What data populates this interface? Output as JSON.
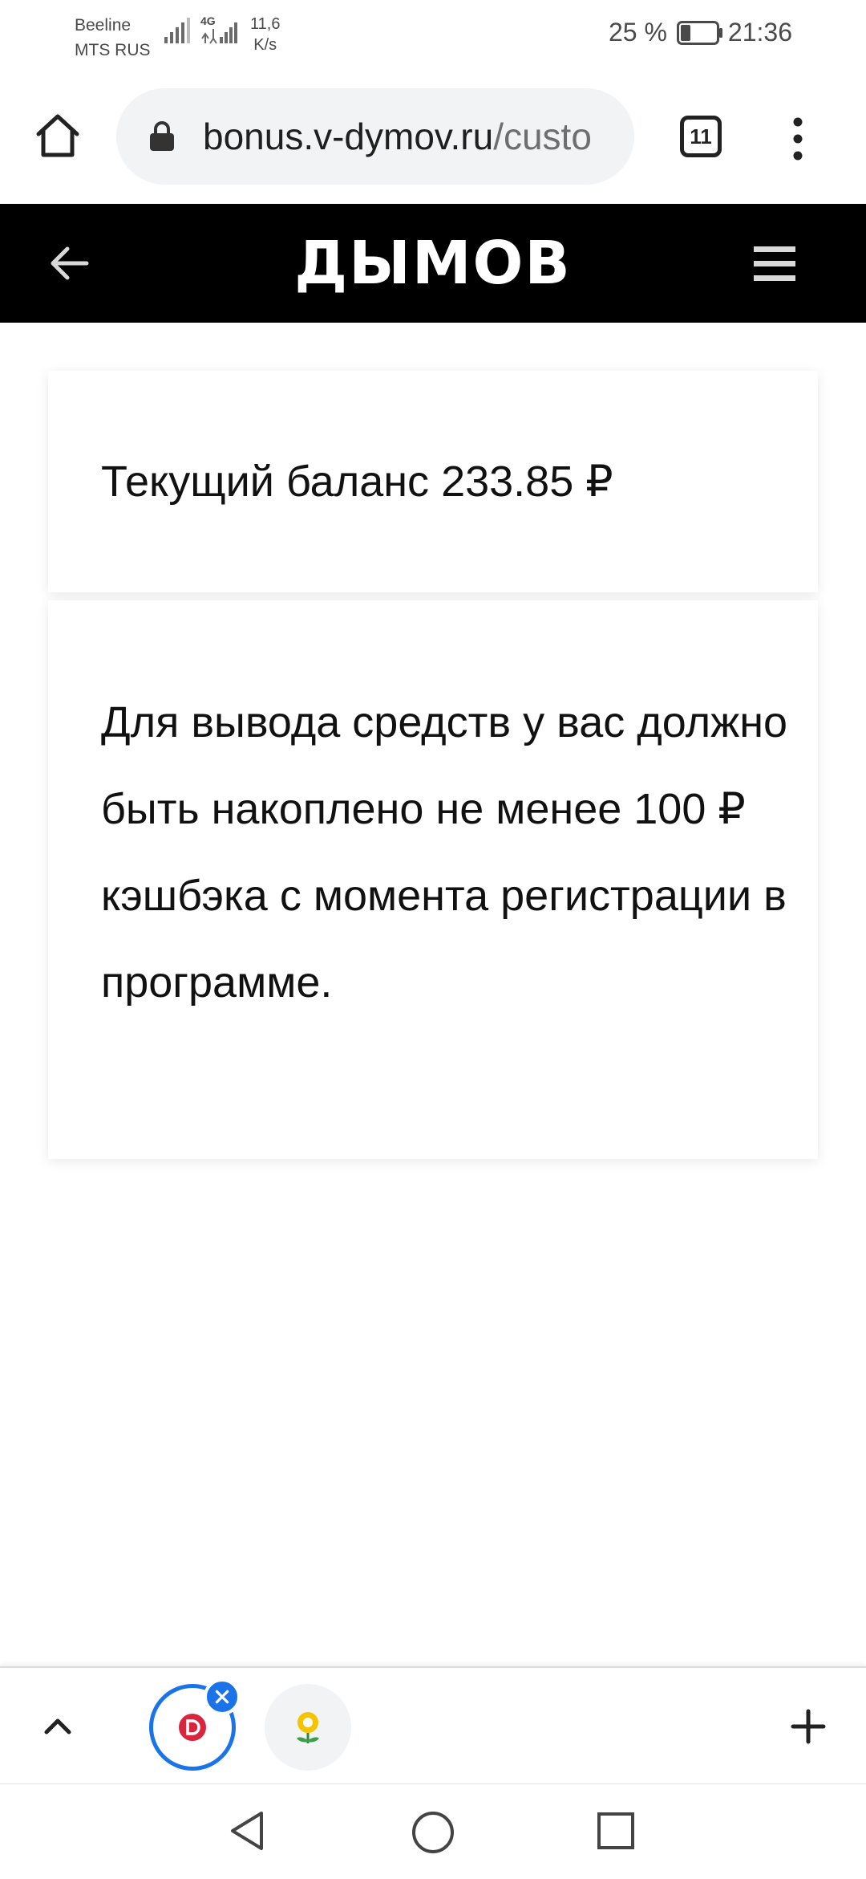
{
  "status_bar": {
    "carrier_1": "Beeline",
    "carrier_2": "MTS RUS",
    "network_type": "4G",
    "speed_value": "11,6",
    "speed_unit": "K/s",
    "battery_percent": "25 %",
    "time": "21:36"
  },
  "browser": {
    "url_host": "bonus.v-dymov.ru",
    "url_path": "/custo",
    "tab_count": "11"
  },
  "site_header": {
    "logo": "ДЫМОВ"
  },
  "balance_card": {
    "text": "Текущий баланс 233.85 ₽"
  },
  "info_card": {
    "text": "Для вывода средств у вас должно быть накоплено не менее 100 ₽ кэшбэка с момента регистрации в программе."
  },
  "tab_strip": {
    "active_tab_icon": "dymov-favicon-icon",
    "second_tab_icon": "flower-favicon-icon"
  },
  "colors": {
    "header_bg": "#000000",
    "accent_blue": "#1a73e8",
    "brand_red": "#d7263d",
    "url_pill_bg": "#f1f3f4"
  }
}
